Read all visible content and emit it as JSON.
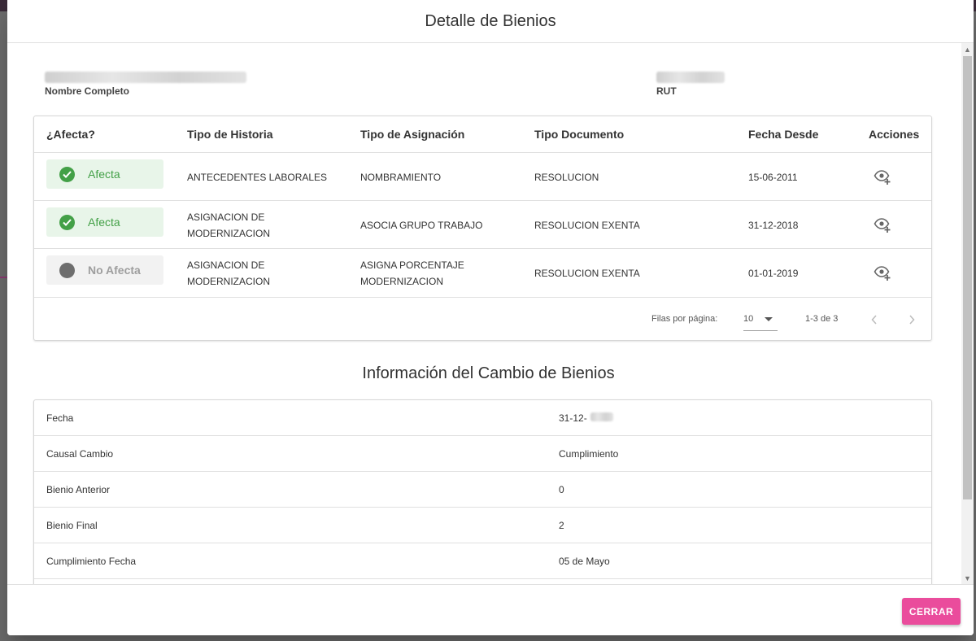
{
  "dialog": {
    "title": "Detalle de Bienios",
    "close_button": "CERRAR"
  },
  "person": {
    "name_label": "Nombre Completo",
    "rut_label": "RUT"
  },
  "history_table": {
    "headers": [
      "¿Afecta?",
      "Tipo de Historia",
      "Tipo de Asignación",
      "Tipo Documento",
      "Fecha Desde",
      "Acciones"
    ],
    "rows": [
      {
        "afecta": "Afecta",
        "afecta_state": "yes",
        "historia": "ANTECEDENTES LABORALES",
        "asignacion": "NOMBRAMIENTO",
        "documento": "RESOLUCION",
        "fecha": "15-06-2011",
        "action_icon": "eye-plus-icon"
      },
      {
        "afecta": "Afecta",
        "afecta_state": "yes",
        "historia": "ASIGNACION DE MODERNIZACION",
        "asignacion": "ASOCIA GRUPO TRABAJO",
        "documento": "RESOLUCION EXENTA",
        "fecha": "31-12-2018",
        "action_icon": "eye-plus-icon"
      },
      {
        "afecta": "No Afecta",
        "afecta_state": "no",
        "historia": "ASIGNACION DE MODERNIZACION",
        "asignacion": "ASIGNA PORCENTAJE MODERNIZACION",
        "documento": "RESOLUCION EXENTA",
        "fecha": "01-01-2019",
        "action_icon": "eye-plus-icon"
      }
    ],
    "pagination": {
      "rows_per_page_label": "Filas por página:",
      "rows_per_page": "10",
      "range": "1-3 de 3"
    }
  },
  "info": {
    "title": "Información del Cambio de Bienios",
    "rows": [
      {
        "key": "Fecha",
        "value": "31-12-"
      },
      {
        "key": "Causal Cambio",
        "value": "Cumplimiento"
      },
      {
        "key": "Bienio Anterior",
        "value": "0"
      },
      {
        "key": "Bienio Final",
        "value": "2"
      },
      {
        "key": "Cumplimiento Fecha",
        "value": "05 de Mayo"
      }
    ]
  },
  "colors": {
    "accent": "#ea4c9c",
    "affects_green": "#43a047",
    "not_affects_grey": "#6e6e6e"
  }
}
